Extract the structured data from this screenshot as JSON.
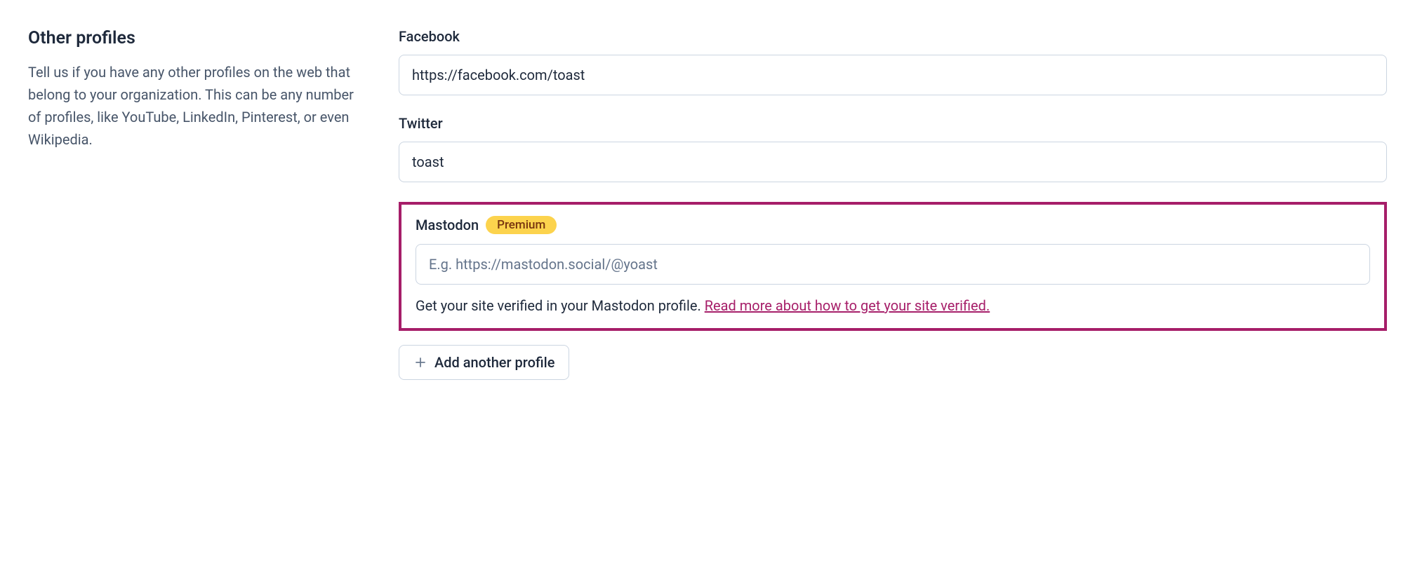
{
  "section": {
    "title": "Other profiles",
    "description": "Tell us if you have any other profiles on the web that belong to your organization. This can be any number of profiles, like YouTube, LinkedIn, Pinterest, or even Wikipedia."
  },
  "fields": {
    "facebook": {
      "label": "Facebook",
      "value": "https://facebook.com/toast",
      "placeholder": ""
    },
    "twitter": {
      "label": "Twitter",
      "value": "toast",
      "placeholder": ""
    },
    "mastodon": {
      "label": "Mastodon",
      "badge": "Premium",
      "value": "",
      "placeholder": "E.g. https://mastodon.social/@yoast",
      "hint_text": "Get your site verified in your Mastodon profile. ",
      "hint_link": "Read more about how to get your site verified."
    }
  },
  "add_button": {
    "label": "Add another profile"
  }
}
